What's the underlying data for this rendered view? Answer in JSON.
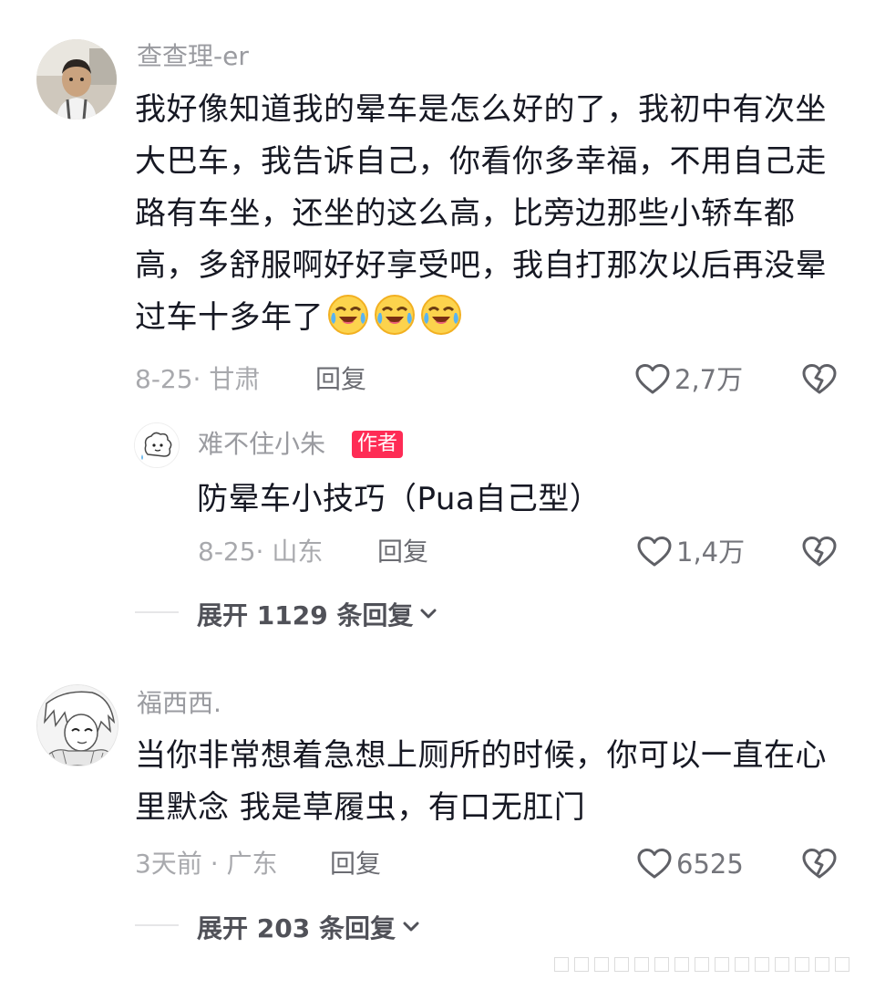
{
  "comments": [
    {
      "username": "查查理-er",
      "text": "我好像知道我的晕车是怎么好的了，我初中有次坐大巴车，我告诉自己，你看你多幸福，不用自己走路有车坐，还坐的这么高，比旁边那些小轿车都高，多舒服啊好好享受吧，我自打那次以后再没晕过车十多年了",
      "emojis": [
        "laugh-cry-emoji",
        "laugh-cry-emoji",
        "laugh-cry-emoji"
      ],
      "meta": "8-25· 甘肃",
      "reply_label": "回复",
      "like_count": "2,7万",
      "reply": {
        "username": "难不住小朱",
        "badge": "作者",
        "text": "防晕车小技巧（Pua自己型）",
        "meta": "8-25· 山东",
        "reply_label": "回复",
        "like_count": "1,4万"
      },
      "expand_label": "展开 1129 条回复"
    },
    {
      "username": "福西西.",
      "text": "当你非常想着急想上厕所的时候，你可以一直在心里默念 我是草履虫，有口无肛门",
      "meta": "3天前 · 广东",
      "reply_label": "回复",
      "like_count": "6525",
      "expand_label": "展开 203 条回复"
    }
  ],
  "colors": {
    "accent": "#fe2c55",
    "text": "#161823",
    "secondary": "#9a9ba0"
  }
}
